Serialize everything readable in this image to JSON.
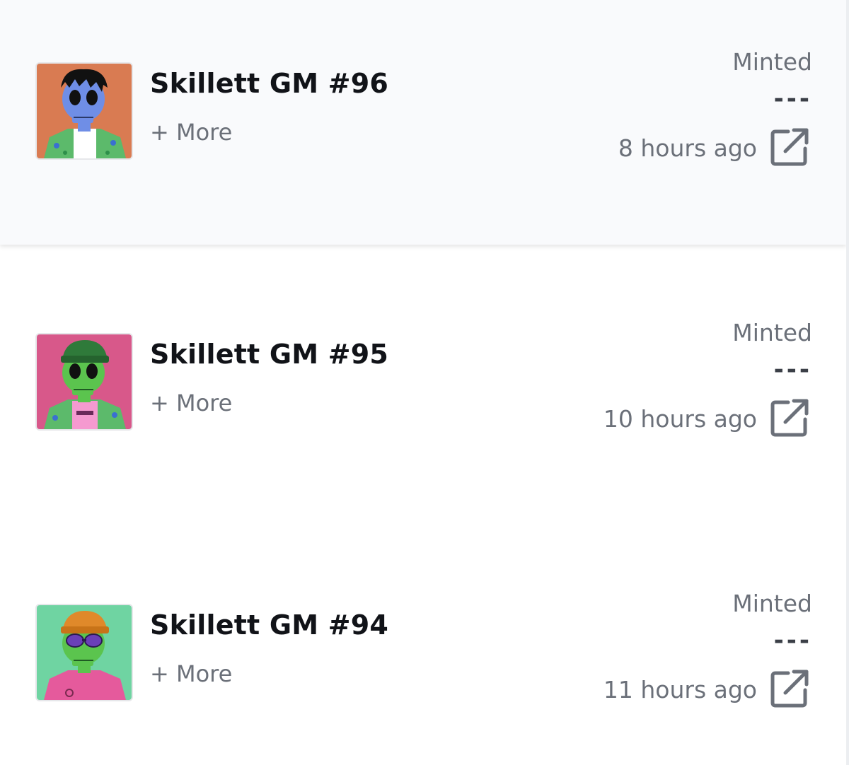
{
  "items": [
    {
      "title": "Skillett GM #96",
      "more_label": "+ More",
      "event": "Minted",
      "price": "---",
      "time": "8 hours ago",
      "colors": {
        "background": "#d97b52",
        "skull": "#6f8ee6",
        "hat": "#111111",
        "shirt": "#5cba6b"
      }
    },
    {
      "title": "Skillett GM #95",
      "more_label": "+ More",
      "event": "Minted",
      "price": "---",
      "time": "10 hours ago",
      "colors": {
        "background": "#d8588a",
        "skull": "#5bc44e",
        "hat": "#2f7a3a",
        "shirt": "#5cba6b"
      }
    },
    {
      "title": "Skillett GM #94",
      "more_label": "+ More",
      "event": "Minted",
      "price": "---",
      "time": "11 hours ago",
      "colors": {
        "background": "#6fd4a2",
        "skull": "#5bc44e",
        "hat": "#e0892a",
        "shirt": "#e55a9c"
      }
    }
  ],
  "icons": {
    "external_link": "external-link-icon"
  }
}
